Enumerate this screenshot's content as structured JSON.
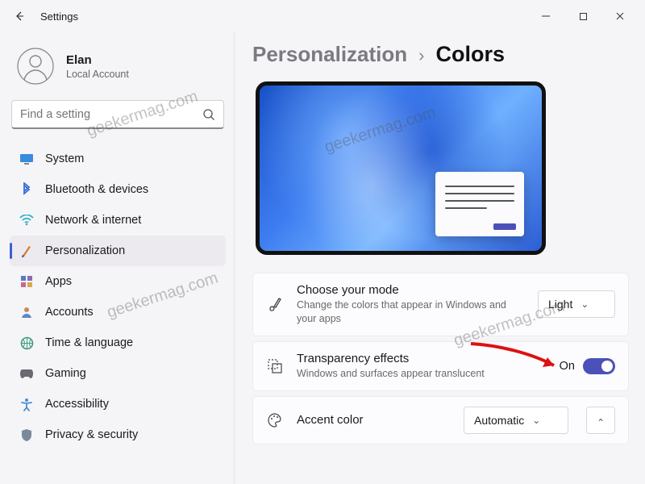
{
  "window": {
    "title": "Settings"
  },
  "user": {
    "name": "Elan",
    "account_type": "Local Account"
  },
  "search": {
    "placeholder": "Find a setting"
  },
  "sidebar": {
    "items": [
      {
        "label": "System"
      },
      {
        "label": "Bluetooth & devices"
      },
      {
        "label": "Network & internet"
      },
      {
        "label": "Personalization"
      },
      {
        "label": "Apps"
      },
      {
        "label": "Accounts"
      },
      {
        "label": "Time & language"
      },
      {
        "label": "Gaming"
      },
      {
        "label": "Accessibility"
      },
      {
        "label": "Privacy & security"
      }
    ],
    "active_index": 3
  },
  "breadcrumb": {
    "parent": "Personalization",
    "current": "Colors"
  },
  "settings": {
    "mode": {
      "title": "Choose your mode",
      "subtitle": "Change the colors that appear in Windows and your apps",
      "value": "Light"
    },
    "transparency": {
      "title": "Transparency effects",
      "subtitle": "Windows and surfaces appear translucent",
      "state_label": "On",
      "enabled": true
    },
    "accent": {
      "title": "Accent color",
      "value": "Automatic"
    }
  },
  "watermark_text": "geekermag.com",
  "colors": {
    "accent": "#4b51b8"
  }
}
